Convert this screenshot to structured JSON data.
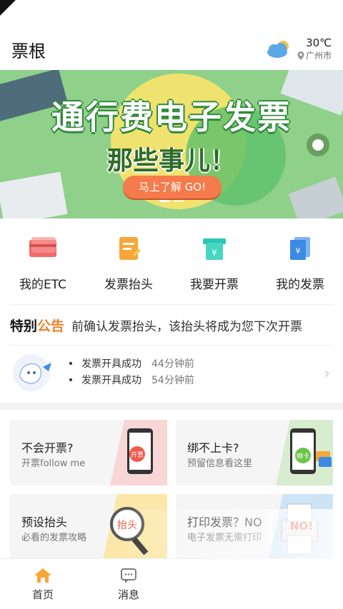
{
  "header": {
    "title": "票根",
    "weather_icon": "cloud-icon",
    "temp": "30℃",
    "city": "广州市"
  },
  "banner": {
    "title": "通行费电子发票",
    "subtitle": "那些事儿！",
    "cta": "马上了解 GO!"
  },
  "quick_actions": [
    {
      "label": "我的ETC",
      "icon": "etc-card-icon"
    },
    {
      "label": "发票抬头",
      "icon": "invoice-header-icon"
    },
    {
      "label": "我要开票",
      "icon": "issue-invoice-icon"
    },
    {
      "label": "我的发票",
      "icon": "my-invoice-icon"
    }
  ],
  "notice": {
    "tag_part1": "特别",
    "tag_part2": "公告",
    "text": "前确认发票抬头，该抬头将成为您下次开票"
  },
  "news": [
    {
      "text": "发票开具成功",
      "time": "44分钟前"
    },
    {
      "text": "发票开具成功",
      "time": "54分钟前"
    }
  ],
  "cards": [
    {
      "title": "不会开票?",
      "sub": "开票follow me",
      "badge": "开票"
    },
    {
      "title": "绑不上卡?",
      "sub": "预留信息看这里",
      "badge": "绑卡"
    },
    {
      "title": "预设抬头",
      "sub": "必看的发票攻略",
      "badge": "抬头"
    },
    {
      "title": "打印发票？NO",
      "sub": "电子发票无需打印",
      "badge": "NO!"
    }
  ],
  "tabs": [
    {
      "label": "首页",
      "icon": "home-icon"
    },
    {
      "label": "消息",
      "icon": "message-icon"
    }
  ],
  "colors": {
    "accent": "#f07f2b",
    "banner_green": "#8ed08a",
    "go_button": "#f57a4c"
  }
}
